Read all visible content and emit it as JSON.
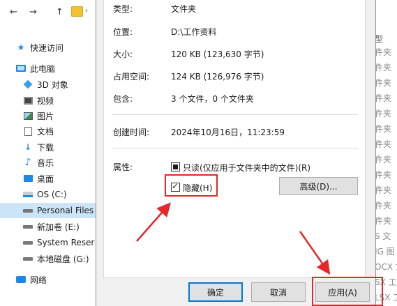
{
  "explorer": {
    "nav": {
      "back": "←",
      "forward": "→",
      "up": "↑",
      "chevron": "›"
    },
    "sidebar": [
      {
        "label": "快速访问",
        "icon": "star-icon",
        "top": 0
      },
      {
        "label": "此电脑",
        "icon": "computer-icon"
      },
      {
        "label": "3D 对象",
        "icon": "3d-objects-icon"
      },
      {
        "label": "视频",
        "icon": "video-icon"
      },
      {
        "label": "图片",
        "icon": "pictures-icon"
      },
      {
        "label": "文档",
        "icon": "documents-icon"
      },
      {
        "label": "下载",
        "icon": "download-icon"
      },
      {
        "label": "音乐",
        "icon": "music-icon"
      },
      {
        "label": "桌面",
        "icon": "desktop-icon"
      },
      {
        "label": "OS (C:)",
        "icon": "os-drive-icon"
      },
      {
        "label": "Personal Files",
        "icon": "drive-icon",
        "selected": true
      },
      {
        "label": "新加卷 (E:)",
        "icon": "drive-icon"
      },
      {
        "label": "System Reser",
        "icon": "drive-icon"
      },
      {
        "label": "本地磁盘 (G:)",
        "icon": "drive-icon"
      },
      {
        "label": "网络",
        "icon": "network-icon"
      }
    ],
    "right_column": {
      "header": "型",
      "cells": [
        "件夹",
        "件夹",
        "件夹",
        "件夹",
        "件夹",
        "件夹",
        "件夹",
        "件夹",
        "件夹",
        "件夹",
        "件夹",
        "件夹",
        "S 文",
        "IG 图",
        "OCX 文",
        "SX 工",
        "LSX 工",
        "SX 工"
      ]
    }
  },
  "dialog": {
    "rows": [
      {
        "label": "类型:",
        "value": "文件夹"
      },
      {
        "label": "位置:",
        "value": "D:\\工作资料"
      },
      {
        "label": "大小:",
        "value": "120 KB (123,630 字节)"
      },
      {
        "label": "占用空间:",
        "value": "124 KB (126,976 字节)"
      },
      {
        "label": "包含:",
        "value": "3 个文件，0 个文件夹"
      },
      {
        "label": "创建时间:",
        "value": "2024年10月16日，11:23:59"
      }
    ],
    "attributes_label": "属性:",
    "readonly_label": "只读(仅应用于文件夹中的文件)(R)",
    "hidden_label": "隐藏(H)",
    "advanced_button": "高级(D)...",
    "ok_button": "确定",
    "cancel_button": "取消",
    "apply_button": "应用(A)"
  },
  "colors": {
    "annotation": "#e5262a",
    "accent": "#0078d7",
    "selected": "#cce4f7"
  }
}
